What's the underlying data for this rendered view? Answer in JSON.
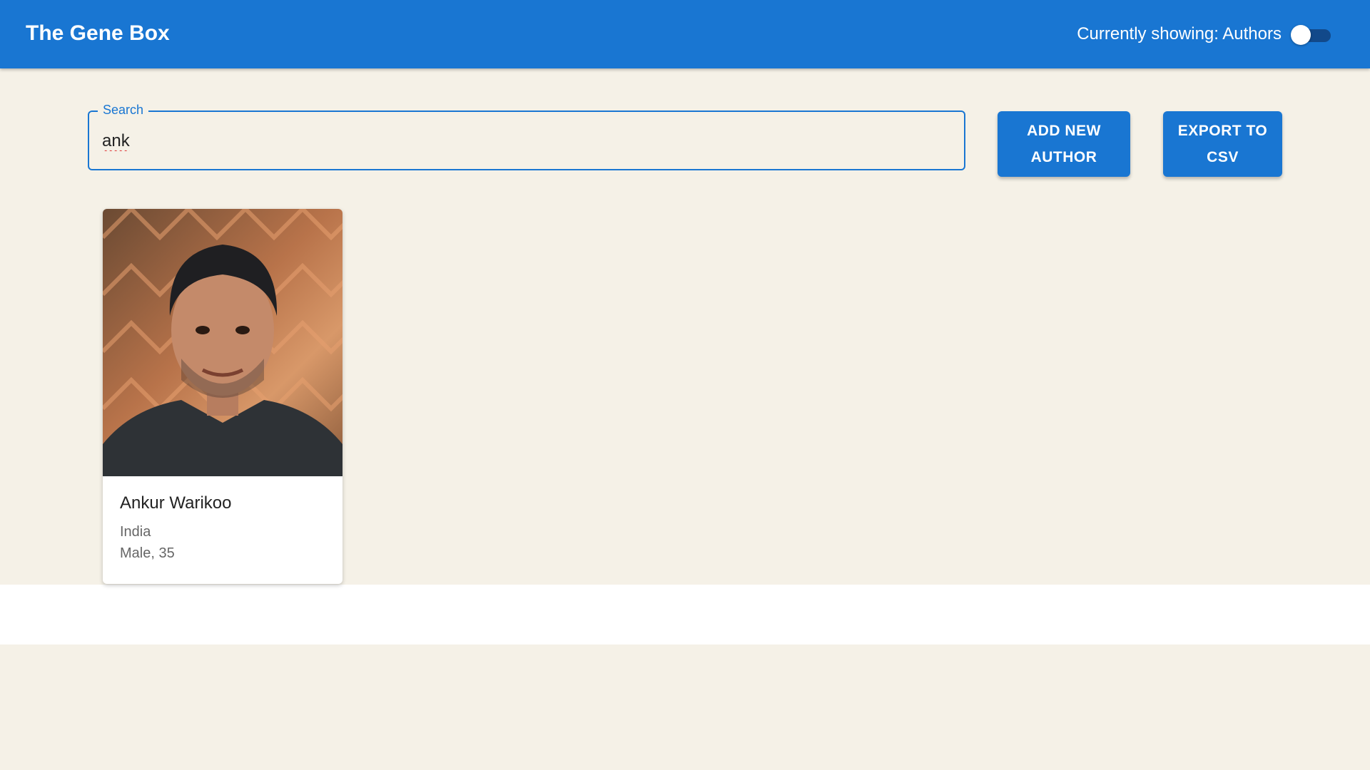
{
  "header": {
    "title": "The Gene Box",
    "showing_text": "Currently showing: Authors",
    "toggle_on": false
  },
  "search": {
    "label": "Search",
    "value": "ank",
    "placeholder": ""
  },
  "actions": {
    "add_line1": "ADD NEW",
    "add_line2": "AUTHOR",
    "export_line1": "EXPORT TO",
    "export_line2": "CSV"
  },
  "authors": [
    {
      "name": "Ankur Warikoo",
      "country": "India",
      "gender_age": "Male, 35"
    }
  ],
  "colors": {
    "primary": "#1976d2",
    "background": "#f5f1e7",
    "toggle_track": "#12498a"
  }
}
